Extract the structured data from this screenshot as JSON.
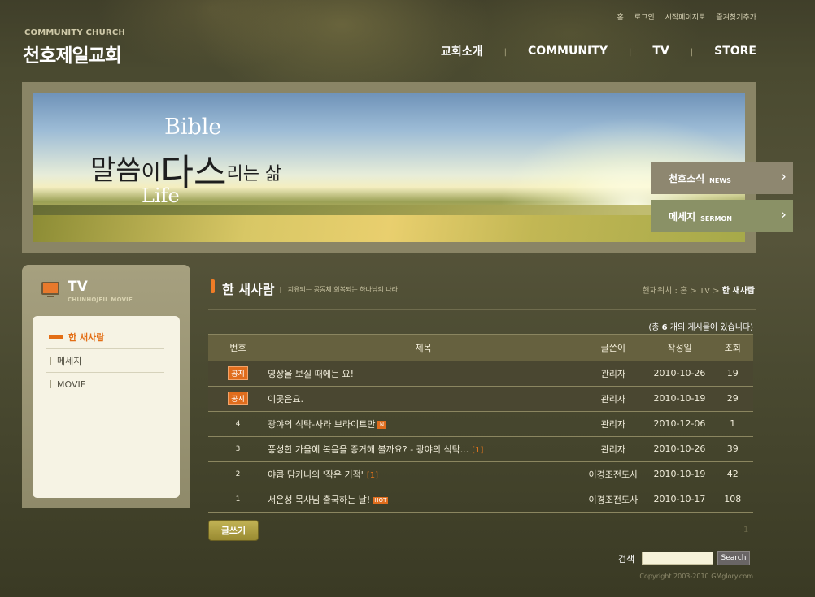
{
  "header": {
    "logo_sub": "COMMUNITY CHURCH",
    "logo_main": "천호제일교회",
    "util_links": [
      "홈",
      "로그인",
      "시작페이지로",
      "즐겨찾기추가"
    ],
    "gnb": [
      "교회소개",
      "COMMUNITY",
      "TV",
      "STORE"
    ]
  },
  "visual": {
    "bible": "Bible",
    "life": "Life",
    "phrase": [
      "말씀",
      "이",
      "다스",
      "리는 삶"
    ],
    "buttons": [
      {
        "ko": "천호소식",
        "en": "NEWS"
      },
      {
        "ko": "메세지",
        "en": "SERMON"
      }
    ]
  },
  "lnb": {
    "title": "TV",
    "sub": "CHUNHOJEIL MOVIE",
    "items": [
      "한 새사람",
      "메세지",
      "MOVIE"
    ],
    "active": "한 새사람"
  },
  "content": {
    "title": "한 새사람",
    "desc": "치유되는 공동체 회복되는 하나님의 나라",
    "location": {
      "prefix": "현재위치 : 홈 > TV > ",
      "current": "한 새사람"
    },
    "total_prefix": "(총 ",
    "total_count": "6",
    "total_suffix": " 개의 게시물이 있습니다)"
  },
  "board": {
    "columns": [
      "번호",
      "제목",
      "글쓴이",
      "작성일",
      "조회"
    ],
    "rows": [
      {
        "no": "공지",
        "notice": true,
        "title": "영상을 보실 때에는 요!",
        "comment": "",
        "badge": "",
        "writer": "관리자",
        "date": "2010-10-26",
        "views": "19"
      },
      {
        "no": "공지",
        "notice": true,
        "title": "이곳은요.",
        "comment": "",
        "badge": "",
        "writer": "관리자",
        "date": "2010-10-19",
        "views": "29"
      },
      {
        "no": "4",
        "notice": false,
        "title": "광야의 식탁-사라 브라이트만",
        "comment": "",
        "badge": "N",
        "writer": "관리자",
        "date": "2010-12-06",
        "views": "1"
      },
      {
        "no": "3",
        "notice": false,
        "title": "풍성한 가을에 복음을 증거해 볼까요? - 광야의 식탁...",
        "comment": "[1]",
        "badge": "",
        "writer": "관리자",
        "date": "2010-10-26",
        "views": "39"
      },
      {
        "no": "2",
        "notice": false,
        "title": "야콥 담카니의 '작은 기적'",
        "comment": "[1]",
        "badge": "",
        "writer": "이경조전도사",
        "date": "2010-10-19",
        "views": "42"
      },
      {
        "no": "1",
        "notice": false,
        "title": "서은성 목사님 출국하는 날!",
        "comment": "",
        "badge": "HOT",
        "writer": "이경조전도사",
        "date": "2010-10-17",
        "views": "108"
      }
    ]
  },
  "footer": {
    "write_button": "글쓰기",
    "page": "1",
    "search_label": "검색",
    "search_value": "",
    "search_button": "Search",
    "copyright": "Copyright 2003-2010 GMglory.com"
  }
}
